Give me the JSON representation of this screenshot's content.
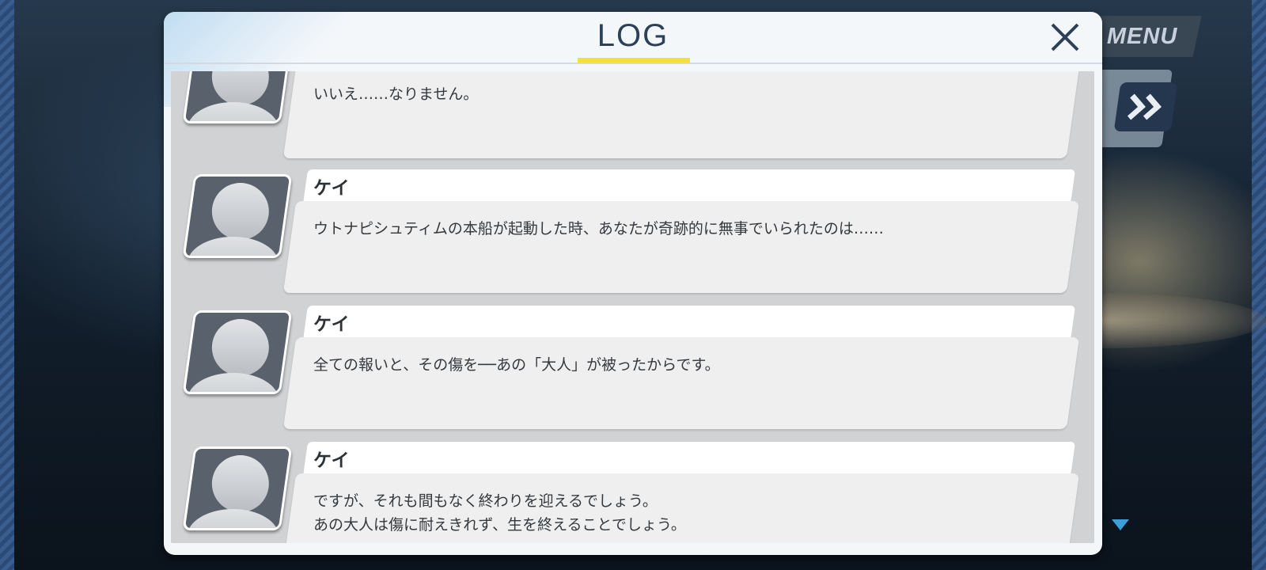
{
  "game_ui": {
    "menu_label": "MENU",
    "skip_icon": "double-chevron-right-icon"
  },
  "log_dialog": {
    "title": "LOG",
    "close_icon": "close-x-icon",
    "title_accent_color": "#f5e03a",
    "entries": [
      {
        "speaker": "",
        "lines": [
          "いいえ……なりません。"
        ]
      },
      {
        "speaker": "ケイ",
        "lines": [
          "ウトナピシュティムの本船が起動した時、あなたが奇跡的に無事でいられたのは……"
        ]
      },
      {
        "speaker": "ケイ",
        "lines": [
          "全ての報いと、その傷を──あの「大人」が被ったからです。"
        ]
      },
      {
        "speaker": "ケイ",
        "lines": [
          "ですが、それも間もなく終わりを迎えるでしょう。",
          "あの大人は傷に耐えきれず、生を終えることでしょう。"
        ]
      }
    ]
  }
}
